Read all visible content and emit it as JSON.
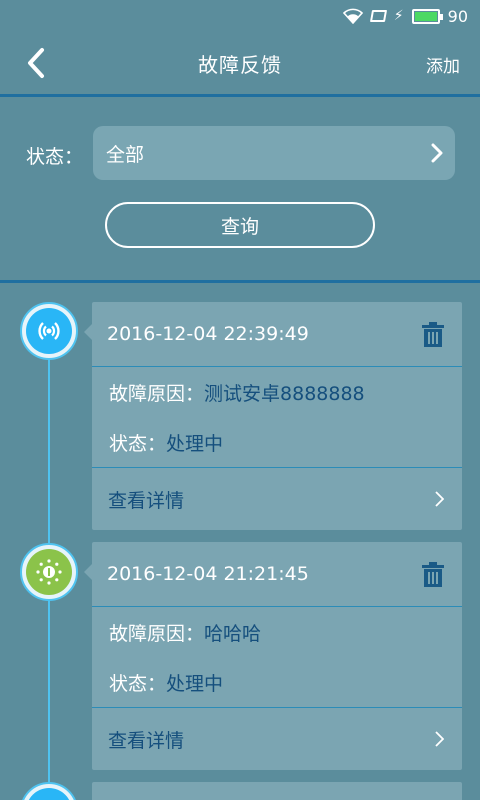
{
  "status_bar": {
    "battery": "90",
    "battery_level": 1.0,
    "icons": [
      "wifi-icon",
      "sim-icon",
      "charging-icon",
      "battery-icon"
    ]
  },
  "header": {
    "title": "故障反馈",
    "add_label": "添加",
    "back_icon": "chevron-left-icon"
  },
  "filter": {
    "label": "状态：",
    "selected": "全部",
    "query_label": "查询"
  },
  "colors": {
    "background": "#5b8d9c",
    "card": "#7ba5b2",
    "accent_blue": "#154f7d",
    "timeline": "#4fc3f0",
    "divider": "#1f6fa0"
  },
  "records": [
    {
      "time": "2016-12-04 22:39:49",
      "reason_label": "故障原因：",
      "reason": "测试安卓8888888",
      "status_label": "状态：",
      "status": "处理中",
      "detail_label": "查看详情",
      "icon": "signal-icon",
      "icon_color": "#29b6f6"
    },
    {
      "time": "2016-12-04 21:21:45",
      "reason_label": "故障原因：",
      "reason": "哈哈哈",
      "status_label": "状态：",
      "status": "处理中",
      "detail_label": "查看详情",
      "icon": "sun-icon",
      "icon_color": "#8bc34a"
    }
  ]
}
